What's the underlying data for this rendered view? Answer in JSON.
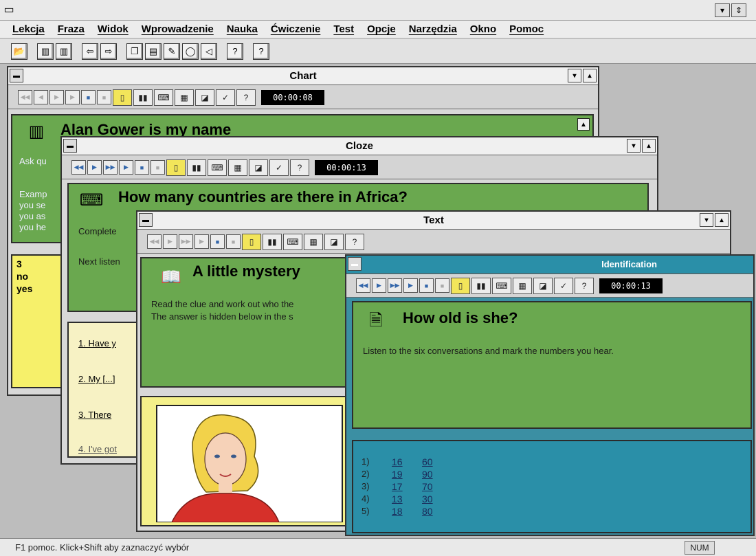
{
  "menu": [
    "Lekcja",
    "Fraza",
    "Widok",
    "Wprowadzenie",
    "Nauka",
    "Ćwiczenie",
    "Test",
    "Opcje",
    "Narzędzia",
    "Okno",
    "Pomoc"
  ],
  "chart": {
    "title": "Chart",
    "timer": "00:00:08",
    "heading": "Alan Gower is my name",
    "text_lines": [
      "Ask qu",
      "Examp",
      "you se",
      "you as",
      "you he"
    ],
    "answers": [
      "3",
      "no",
      "yes"
    ]
  },
  "cloze": {
    "title": "Cloze",
    "timer": "00:00:13",
    "heading": "How many countries are there in Africa?",
    "text_lines": [
      "Complete",
      "Next listen"
    ],
    "items": [
      "1.  Have y",
      "2.  My [...]",
      "3.  There",
      "4.  I've got"
    ]
  },
  "text": {
    "title": "Text",
    "heading": "A little mystery",
    "text_lines": [
      "Read the clue and work out who the",
      "The answer is hidden below in the s"
    ]
  },
  "identification": {
    "title": "Identification",
    "timer": "00:00:13",
    "heading": "How old is she?",
    "instructions": "Listen to the six conversations and mark the numbers you hear.",
    "numbers": [
      {
        "idx": "1)",
        "a": "16",
        "b": "60"
      },
      {
        "idx": "2)",
        "a": "19",
        "b": "90"
      },
      {
        "idx": "3)",
        "a": "17",
        "b": "70"
      },
      {
        "idx": "4)",
        "a": "13",
        "b": "30"
      },
      {
        "idx": "5)",
        "a": "18",
        "b": "80"
      }
    ]
  },
  "status": {
    "hint": "F1 pomoc. Klick+Shift aby zaznaczyć wybór",
    "num": "NUM"
  },
  "colors": {
    "green": "#6aa84f",
    "teal": "#2a8fa8",
    "yellow": "#f6f06a"
  }
}
